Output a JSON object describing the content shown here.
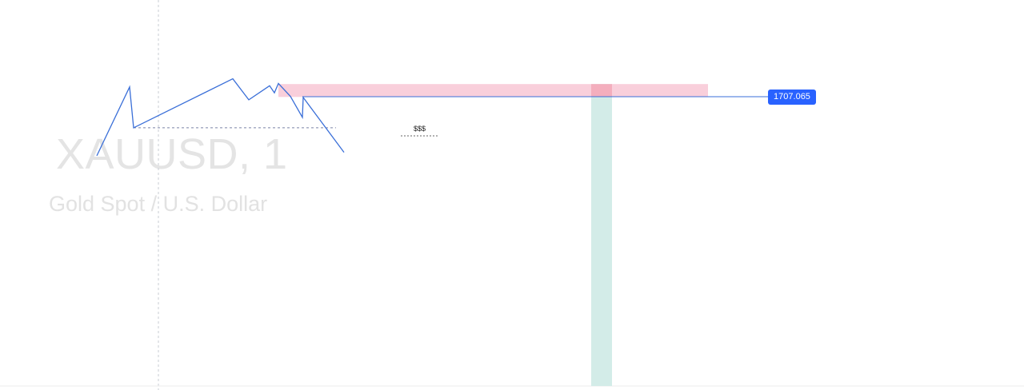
{
  "watermark": {
    "symbol": "XAUUSD, 1",
    "description": "Gold Spot / U.S. Dollar"
  },
  "annotations": {
    "level_note": "$$$"
  },
  "price_scale": {
    "current_price_label": "1707.065"
  },
  "colors": {
    "line": "#3a6fd8",
    "price_label_bg": "#2962ff",
    "supply_zone": "#f9cfdb",
    "overlap_zone": "#f4aebd",
    "vertical_zone": "#d3ece8",
    "crosshair": "#c9ccd3",
    "dashed_level": "#7b82a8"
  },
  "chart_data": {
    "type": "line",
    "series": [
      {
        "values": [
          1702.0,
          1707.9,
          1704.4,
          1708.6,
          1706.8,
          1708.0,
          1707.4,
          1708.2,
          1707.1,
          1705.3,
          1707.0,
          1702.3
        ]
      }
    ],
    "current_price": 1707.065,
    "horizontal_levels": [
      {
        "price": 1707.065,
        "style": "solid"
      },
      {
        "price": 1704.4,
        "style": "dashed"
      }
    ],
    "zones": [
      {
        "type": "supply",
        "price_top": 1708.15,
        "price_bottom": 1707.05
      },
      {
        "type": "vertical"
      }
    ],
    "grid": false
  }
}
